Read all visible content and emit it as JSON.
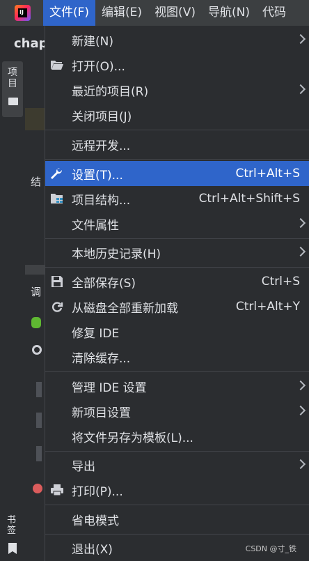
{
  "app": {
    "logo_text": "IJ",
    "bg_title": "chap"
  },
  "menubar": [
    {
      "label": "文件(F)",
      "active": true
    },
    {
      "label": "编辑(E)"
    },
    {
      "label": "视图(V)"
    },
    {
      "label": "导航(N)"
    },
    {
      "label": "代码"
    }
  ],
  "left_panel": {
    "project_tab": "项目",
    "bookmarks_tab": "书签",
    "structure_label": "结",
    "debug_label": "调"
  },
  "menu": {
    "new": {
      "label": "新建(N)"
    },
    "open": {
      "label": "打开(O)..."
    },
    "recent": {
      "label": "最近的项目(R)"
    },
    "close": {
      "label": "关闭项目(J)"
    },
    "remote": {
      "label": "远程开发..."
    },
    "settings": {
      "label": "设置(T)...",
      "shortcut": "Ctrl+Alt+S"
    },
    "project_structure": {
      "label": "项目结构...",
      "shortcut": "Ctrl+Alt+Shift+S"
    },
    "file_properties": {
      "label": "文件属性"
    },
    "local_history": {
      "label": "本地历史记录(H)"
    },
    "save_all": {
      "label": "全部保存(S)",
      "shortcut": "Ctrl+S"
    },
    "reload": {
      "label": "从磁盘全部重新加载",
      "shortcut": "Ctrl+Alt+Y"
    },
    "repair": {
      "label": "修复 IDE"
    },
    "invalidate": {
      "label": "清除缓存..."
    },
    "manage_ide": {
      "label": "管理 IDE 设置"
    },
    "new_project_settings": {
      "label": "新项目设置"
    },
    "save_as_template": {
      "label": "将文件另存为模板(L)..."
    },
    "export": {
      "label": "导出"
    },
    "print": {
      "label": "打印(P)..."
    },
    "power_save": {
      "label": "省电模式"
    },
    "exit": {
      "label": "退出(X)"
    }
  },
  "watermark": "CSDN @寸_铁",
  "colors": {
    "accent": "#2f65ca",
    "menubar": "#3c3f41",
    "background": "#2b2d30"
  }
}
